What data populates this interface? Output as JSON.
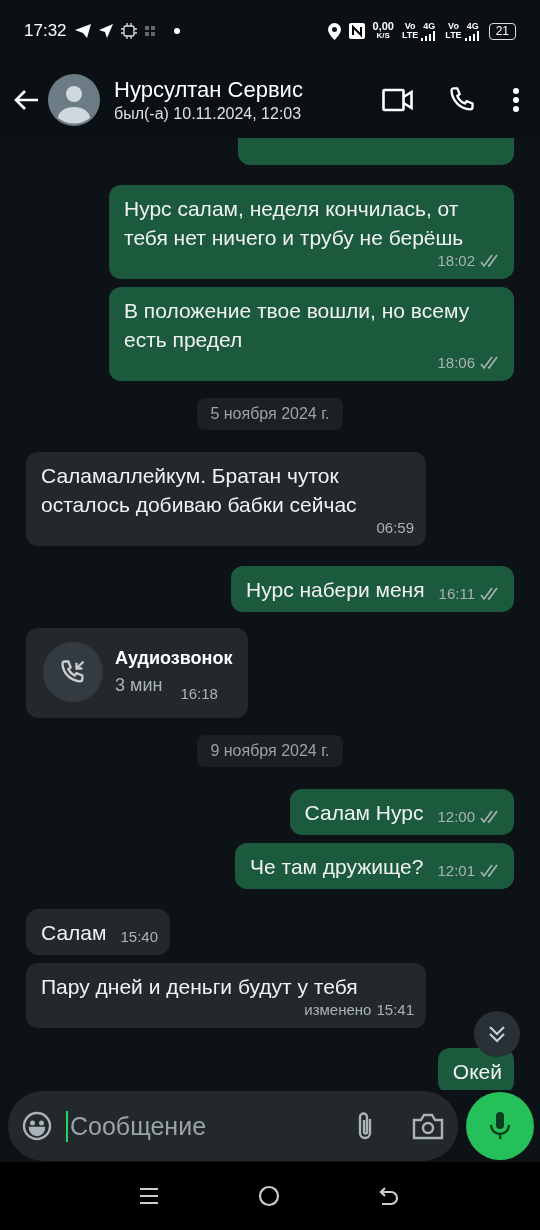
{
  "status_bar": {
    "time": "17:32",
    "speed": "0,00",
    "speed_unit": "K/S",
    "sims": [
      {
        "vo": "Vo",
        "lte": "LTE",
        "network": "4G"
      },
      {
        "vo": "Vo",
        "lte": "LTE",
        "network": "4G"
      }
    ],
    "battery": "21"
  },
  "header": {
    "name": "Нурсултан Сервис",
    "last_seen": "был(-а) 10.11.2024, 12:03"
  },
  "messages": [
    {
      "kind": "cut"
    },
    {
      "kind": "out",
      "text": "Нурс салам, неделя кончилась, от тебя нет ничего и трубу не берёшь",
      "time": "18:02"
    },
    {
      "kind": "out",
      "text": "В положение твое вошли, но всему есть предел",
      "time": "18:06"
    },
    {
      "kind": "date",
      "text": "5 ноября 2024 г."
    },
    {
      "kind": "in",
      "text": "Саламаллейкум. Братан чуток осталось добиваю бабки сейчас",
      "time": "06:59"
    },
    {
      "kind": "out",
      "text": "Нурс набери меня",
      "time": "16:11"
    },
    {
      "kind": "call",
      "title": "Аудиозвонок",
      "duration": "3 мин",
      "time": "16:18"
    },
    {
      "kind": "date",
      "text": "9 ноября 2024 г."
    },
    {
      "kind": "out",
      "text": "Салам Нурс",
      "time": "12:00"
    },
    {
      "kind": "out",
      "text": "Че там дружище?",
      "time": "12:01"
    },
    {
      "kind": "in",
      "text": "Салам",
      "time": "15:40"
    },
    {
      "kind": "in",
      "text": "Пару дней и деньги будут у тебя",
      "edited": "изменено",
      "time": "15:41"
    },
    {
      "kind": "out",
      "text": "Окей"
    }
  ],
  "composer": {
    "placeholder": "Сообщение"
  }
}
